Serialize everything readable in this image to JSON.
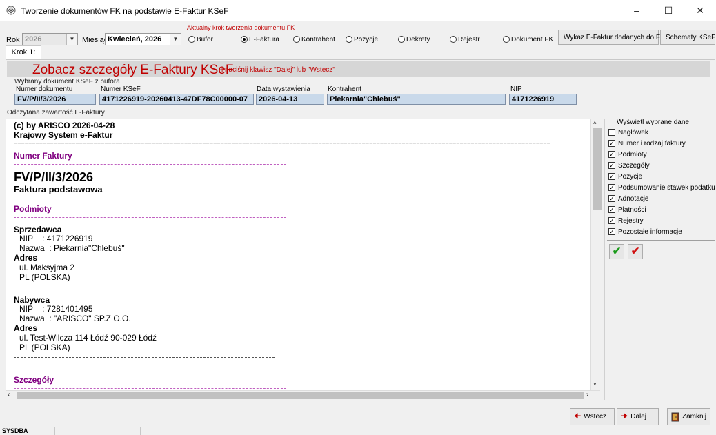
{
  "window": {
    "title": "Tworzenie dokumentów FK na podstawie E-Faktur KSeF"
  },
  "toolbar": {
    "rok_label": "Rok",
    "rok_value": "2026",
    "miesiac_label": "Miesiąc",
    "miesiac_value": "Kwiecień, 2026",
    "step_group_label": "Aktualny krok tworzenia dokumentu FK",
    "steps": [
      "Bufor",
      "E-Faktura",
      "Kontrahent",
      "Pozycje",
      "Dekrety",
      "Rejestr",
      "Dokument FK"
    ],
    "selected_step": "E-Faktura",
    "wykaz_button": "Wykaz E-Faktur dodanych do FK",
    "schematy_button": "Schematy KSeF"
  },
  "tab": {
    "label": "Krok 1:"
  },
  "heading": {
    "main": "Zobacz szczegóły E-Faktury KSeF",
    "hint": "i naciśnij klawisz \"Dalej\" lub \"Wstecz\""
  },
  "selected_doc": {
    "group_label": "Wybrany dokument KSeF z bufora",
    "numer_dokumentu_label": "Numer dokumentu",
    "numer_dokumentu": "FV/P/II/3/2026",
    "numer_ksef_label": "Numer KSeF",
    "numer_ksef": "4171226919-20260413-47DF78C00000-07",
    "data_wystawienia_label": "Data wystawienia",
    "data_wystawienia": "2026-04-13",
    "kontrahent_label": "Kontrahent",
    "kontrahent": "Piekarnia\"Chlebuś\"",
    "nip_label": "NIP",
    "nip": "4171226919"
  },
  "content_label": "Odczytana zawartość E-Faktury",
  "invoice": {
    "header_line1": "(c) by ARISCO 2026-04-28",
    "header_line2": "Krajowy System e-Faktur",
    "separator": "====================================================================================================================================================",
    "numer_faktury_heading": "Numer Faktury",
    "invoice_number": "FV/P/II/3/2026",
    "invoice_type": "Faktura podstawowa",
    "podmioty_heading": "Podmioty",
    "seller_label": "Sprzedawca",
    "seller_nip": "NIP    : 4171226919",
    "seller_name": "Nazwa  : Piekarnia\"Chlebuś\"",
    "seller_addr_label": "Adres",
    "seller_addr1": "ul. Maksyjma 2",
    "seller_addr2": "PL (POLSKA)",
    "buyer_label": "Nabywca",
    "buyer_nip": "NIP    : 7281401495",
    "buyer_name": "Nazwa  : \"ARISCO\" SP.Z O.O.",
    "buyer_addr_label": "Adres",
    "buyer_addr1": "ul. Test-Wilcza 114 Łódź 90-029 Łódź",
    "buyer_addr2": "PL (POLSKA)",
    "szczegoly_heading": "Szczegóły"
  },
  "display_options": {
    "label": "Wyświetl wybrane dane",
    "items": [
      {
        "label": "Nagłówek",
        "checked": false
      },
      {
        "label": "Numer i rodzaj faktury",
        "checked": true
      },
      {
        "label": "Podmioty",
        "checked": true
      },
      {
        "label": "Szczegóły",
        "checked": true
      },
      {
        "label": "Pozycje",
        "checked": true
      },
      {
        "label": "Podsumowanie stawek podatku",
        "checked": true
      },
      {
        "label": "Adnotacje",
        "checked": true
      },
      {
        "label": "Płatności",
        "checked": true
      },
      {
        "label": "Rejestry",
        "checked": true
      },
      {
        "label": "Pozostałe informacje",
        "checked": true
      }
    ]
  },
  "buttons": {
    "wstecz": "Wstecz",
    "dalej": "Dalej",
    "zamknij": "Zamknij"
  },
  "status": {
    "user": "SYSDBA"
  },
  "colors": {
    "heading_red": "#c00000",
    "section_purple": "#800080",
    "field_bg": "#c9d9ea"
  }
}
